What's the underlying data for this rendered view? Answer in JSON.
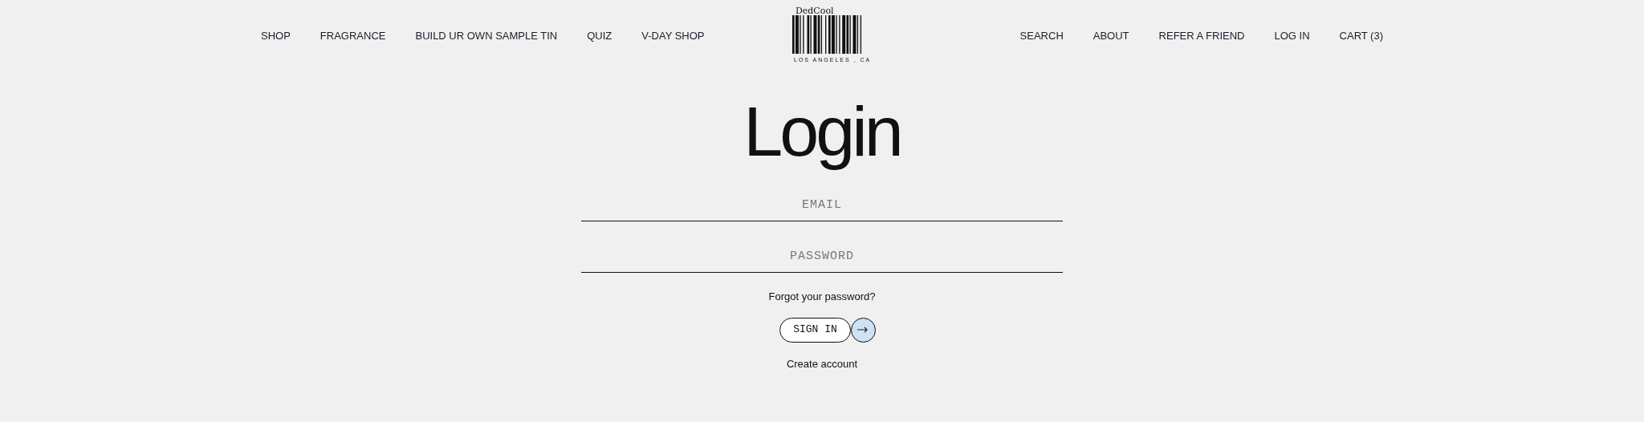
{
  "nav_left": [
    "SHOP",
    "FRAGRANCE",
    "BUILD UR OWN SAMPLE TIN",
    "QUIZ",
    "V-DAY SHOP"
  ],
  "logo": {
    "brand": "DedCool",
    "location": "LOS ANGELES , CA"
  },
  "nav_right": [
    "SEARCH",
    "ABOUT",
    "REFER A FRIEND",
    "LOG IN",
    "CART (3)"
  ],
  "title": "Login",
  "fields": [
    {
      "placeholder": "EMAIL"
    },
    {
      "placeholder": "PASSWORD"
    }
  ],
  "forgot_link": "Forgot your password?",
  "sign_in_button": "SIGN IN",
  "create_account_link": "Create account"
}
